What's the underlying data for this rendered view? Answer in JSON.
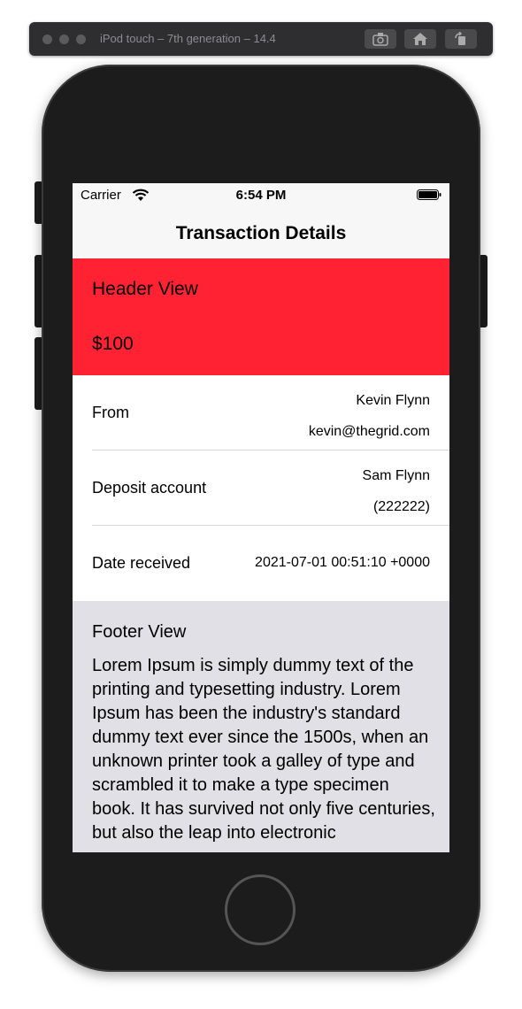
{
  "simulator": {
    "title": "iPod touch – 7th generation – 14.4"
  },
  "status_bar": {
    "carrier": "Carrier",
    "time": "6:54 PM"
  },
  "nav": {
    "title": "Transaction Details"
  },
  "header": {
    "title": "Header View",
    "amount": "$100",
    "color": "#ff2233"
  },
  "rows": [
    {
      "label": "From",
      "value_line1": "Kevin Flynn",
      "value_line2": "kevin@thegrid.com"
    },
    {
      "label": "Deposit account",
      "value_line1": "Sam Flynn",
      "value_line2": "(222222)"
    },
    {
      "label": "Date received",
      "value": "2021-07-01 00:51:10 +0000"
    }
  ],
  "footer": {
    "title": "Footer View",
    "body": "Lorem Ipsum is simply dummy text of the printing and typesetting industry. Lorem Ipsum has been the industry's standard dummy text ever since the 1500s, when an unknown printer took a galley of type and scrambled it to make a type specimen book. It has survived not only five centuries, but also the leap into electronic"
  },
  "icons": {
    "screenshot": "camera-icon",
    "home": "home-icon",
    "rotate": "rotate-icon"
  }
}
